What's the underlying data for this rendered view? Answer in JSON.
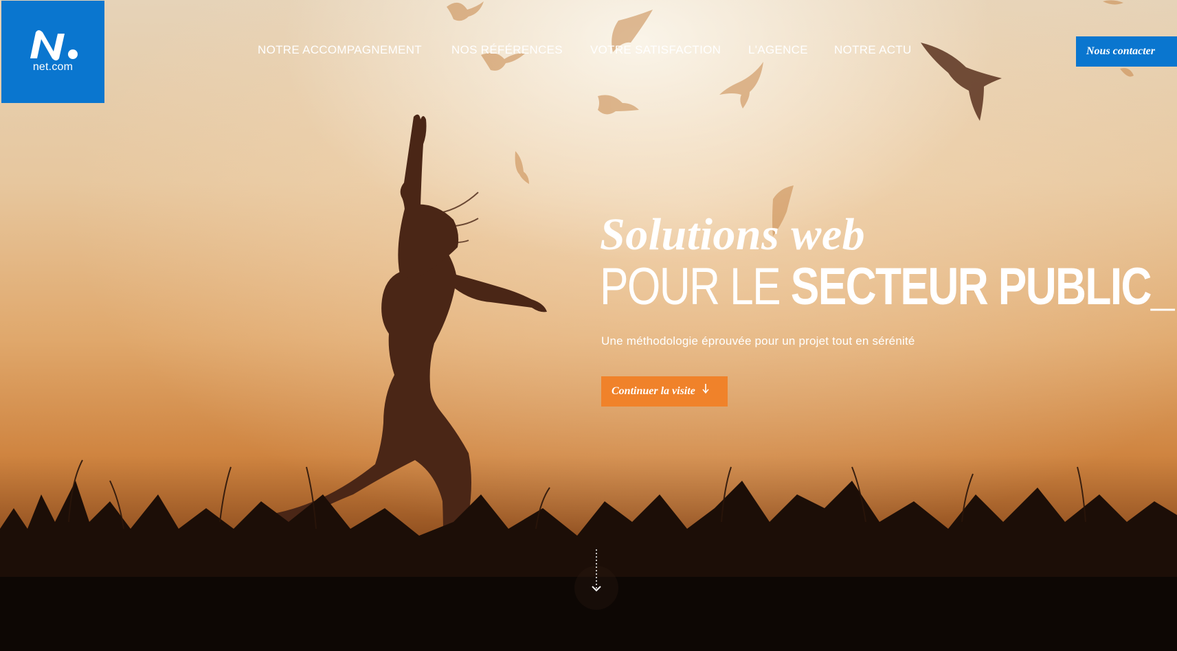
{
  "logo": {
    "text": "net.com",
    "icon": "netcom-logo-icon"
  },
  "nav": {
    "items": [
      {
        "label": "NOTRE ACCOMPAGNEMENT"
      },
      {
        "label": "NOS RÉFÉRENCES"
      },
      {
        "label": "VOTRE SATISFACTION"
      },
      {
        "label": "L'AGENCE"
      },
      {
        "label": "NOTRE ACTU"
      }
    ]
  },
  "contact_button": {
    "label": "Nous contacter"
  },
  "hero": {
    "headline_line1": "Solutions web",
    "headline_line2_light": "POUR LE ",
    "headline_line2_bold": "SECTEUR PUBLIC_",
    "tagline": "Une méthodologie éprouvée pour un projet tout en sérénité",
    "cta_label": "Continuer la visite",
    "cta_icon": "arrow-down-icon",
    "scroll_icon": "scroll-down-icon",
    "background": "sunset-silhouette-photo"
  },
  "colors": {
    "brand_blue": "#0a76cf",
    "cta_orange": "#f0822a",
    "text": "#ffffff"
  }
}
